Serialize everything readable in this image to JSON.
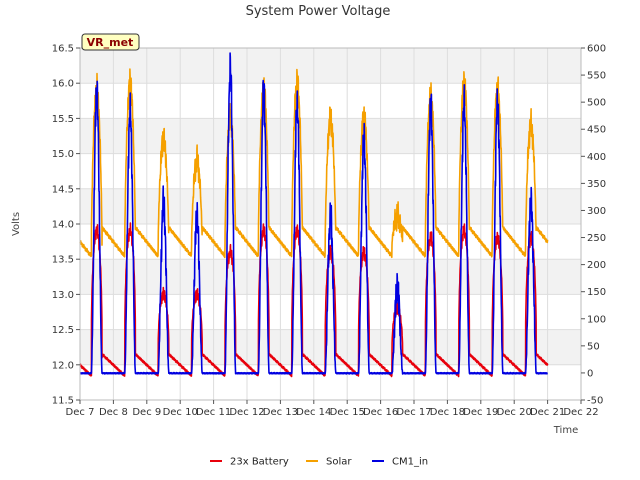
{
  "chart_data": {
    "type": "line",
    "title": "System Power Voltage",
    "xlabel": "Time",
    "ylabel": "Volts",
    "badge": "VR_met",
    "x_ticks": [
      "Dec 7",
      "Dec 8",
      "Dec 9",
      "Dec 10",
      "Dec 11",
      "Dec 12",
      "Dec 13",
      "Dec 14",
      "Dec 15",
      "Dec 16",
      "Dec 17",
      "Dec 18",
      "Dec 19",
      "Dec 20",
      "Dec 21",
      "Dec 22"
    ],
    "xlim": [
      7,
      22
    ],
    "ylim": [
      11.5,
      16.5
    ],
    "y_ticks": [
      "11.5",
      "12.0",
      "12.5",
      "13.0",
      "13.5",
      "14.0",
      "14.5",
      "15.0",
      "15.5",
      "16.0",
      "16.5"
    ],
    "y2lim": [
      -50,
      600
    ],
    "y2_ticks": [
      "-50",
      "0",
      "50",
      "100",
      "150",
      "200",
      "250",
      "300",
      "350",
      "400",
      "450",
      "500",
      "550",
      "600"
    ],
    "grid": true,
    "legend_position": "bottom",
    "daily_peaks": {
      "days": [
        7.5,
        8.5,
        9.5,
        10.5,
        11.5,
        12.5,
        13.5,
        14.5,
        15.5,
        16.5,
        17.5,
        18.5,
        19.5,
        20.5
      ],
      "battery_peak": [
        13.9,
        13.9,
        13.0,
        13.0,
        13.6,
        13.9,
        13.9,
        13.6,
        13.6,
        12.8,
        13.8,
        13.9,
        13.8,
        13.8
      ],
      "solar_peak_volts": [
        15.9,
        16.0,
        15.2,
        14.9,
        15.5,
        15.9,
        16.0,
        15.5,
        15.5,
        14.1,
        15.8,
        16.0,
        15.9,
        15.4
      ],
      "cm1_peak_volts": [
        15.9,
        15.6,
        14.3,
        14.1,
        16.2,
        15.9,
        15.7,
        14.1,
        15.2,
        13.1,
        15.7,
        15.7,
        15.7,
        14.3
      ]
    },
    "series": [
      {
        "name": "23x Battery",
        "color": "#e8000b",
        "axis": "left"
      },
      {
        "name": "Solar",
        "color": "#f5a000",
        "axis": "left"
      },
      {
        "name": "CM1_in",
        "color": "#0000e0",
        "axis": "left"
      }
    ]
  }
}
